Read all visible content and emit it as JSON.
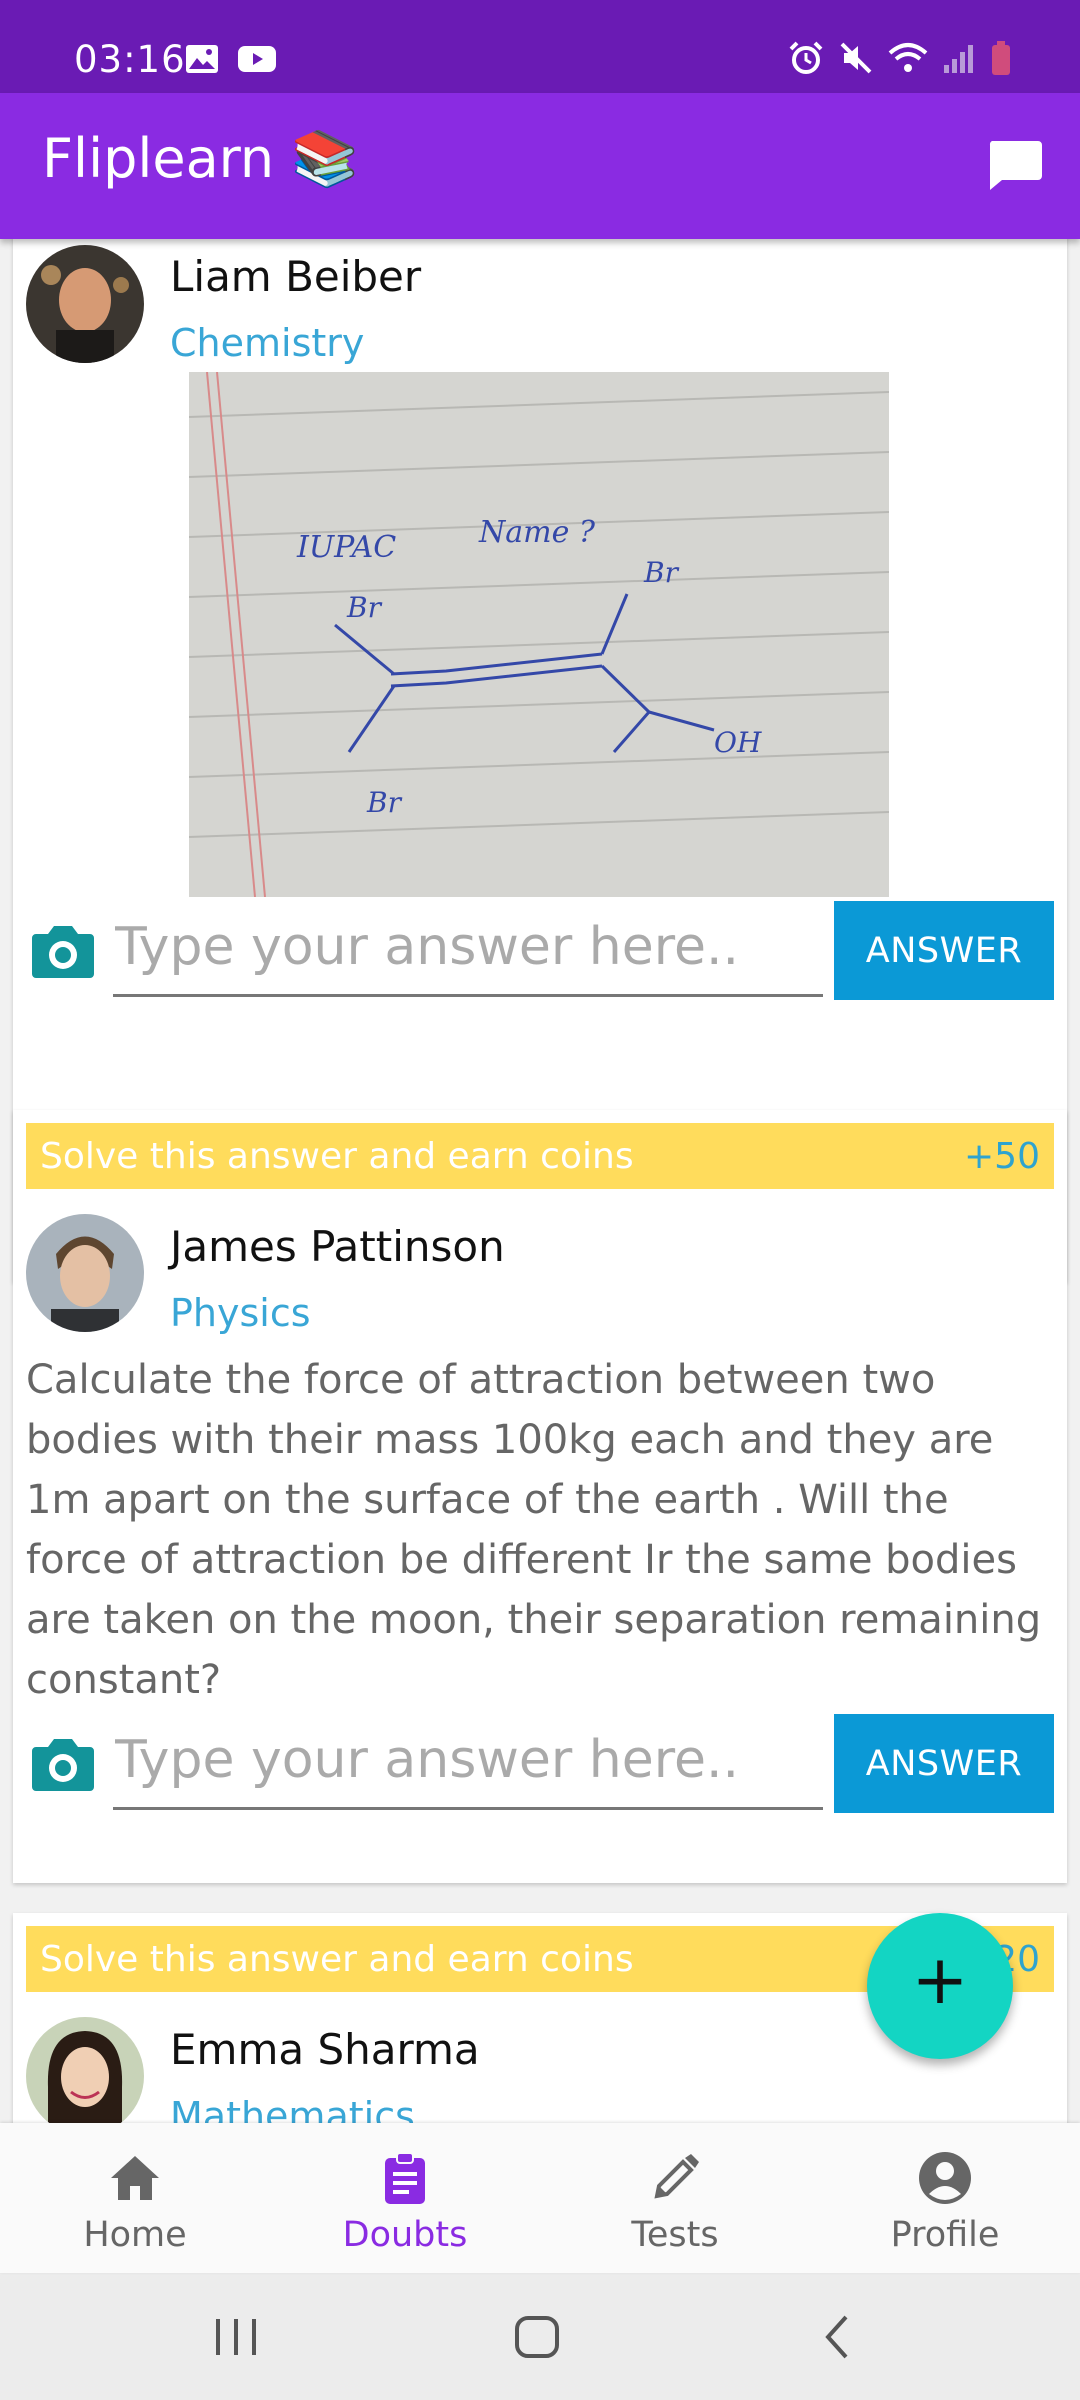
{
  "status_bar": {
    "time": "03:16"
  },
  "app_bar": {
    "title": "Fliplearn 📚"
  },
  "doubts": [
    {
      "user_name": "Liam Beiber",
      "subject": "Chemistry",
      "image_text": {
        "iupac": "IUPAC",
        "name": "Name ?",
        "br": "Br",
        "oh": "OH"
      },
      "answer_placeholder": "Type your answer here..",
      "answer_button": "ANSWER"
    },
    {
      "banner_text": "Solve this answer and earn coins",
      "coins": "+50",
      "user_name": "James Pattinson",
      "subject": "Physics",
      "question": "Calculate the force of attraction between two bodies with their mass 100kg each and they are 1m apart on the surface of the earth . Will the force of attraction be different Ir the same bodies are taken on the moon, their separation remaining constant?",
      "answer_placeholder": "Type your answer here..",
      "answer_button": "ANSWER"
    },
    {
      "banner_text": "Solve this answer and earn coins",
      "coins": "+20",
      "user_name": "Emma Sharma",
      "subject": "Mathematics"
    }
  ],
  "fab": {
    "label": "+"
  },
  "bottom_nav": [
    {
      "label": "Home",
      "icon": "home-icon",
      "active": false
    },
    {
      "label": "Doubts",
      "icon": "clipboard-icon",
      "active": true
    },
    {
      "label": "Tests",
      "icon": "pencil-icon",
      "active": false
    },
    {
      "label": "Profile",
      "icon": "account-circle-icon",
      "active": false
    }
  ],
  "colors": {
    "status_bar": "#6a1bb4",
    "app_bar": "#8a2be2",
    "accent_blue": "#0b99d6",
    "subject_blue": "#39a6d6",
    "banner_yellow": "#ffdc5c",
    "fab_teal": "#13d5c3",
    "camera_teal": "#13949a"
  }
}
